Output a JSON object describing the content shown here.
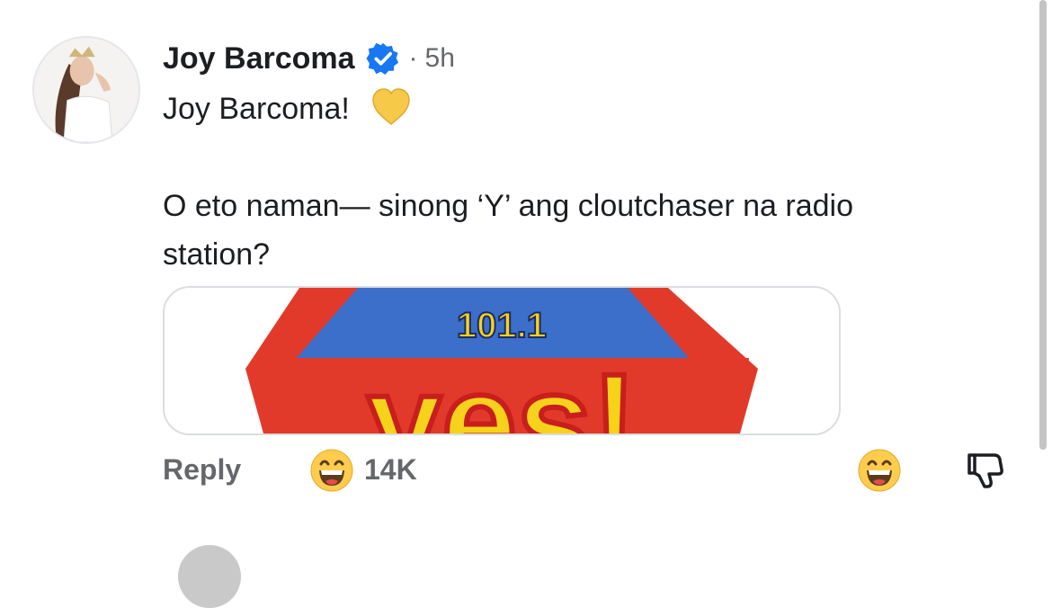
{
  "comment": {
    "author": "Joy Barcoma",
    "verified_icon": "verified-badge-icon",
    "separator": "·",
    "time": "5h",
    "text_line1": "Joy Barcoma!",
    "heart_icon": "yellow-heart-icon",
    "text_line2": "O eto naman— sinong ‘Y’ ang cloutchaser na radio",
    "text_line3": "station?",
    "attachment": {
      "logo_number": "101.1",
      "logo_word": "yes!",
      "colors": {
        "red": "#e23a2a",
        "blue": "#3b6fc9",
        "yellow": "#f7d21b"
      }
    }
  },
  "actions": {
    "reply_label": "Reply",
    "reaction_icon": "laughing-emoji-icon",
    "reaction_count": "14K",
    "react_button_icon": "laughing-emoji-icon",
    "dislike_icon": "thumbs-down-icon"
  },
  "colors": {
    "verified": "#1877f2",
    "secondary_text": "#65676b",
    "heart": "#f7c948"
  }
}
